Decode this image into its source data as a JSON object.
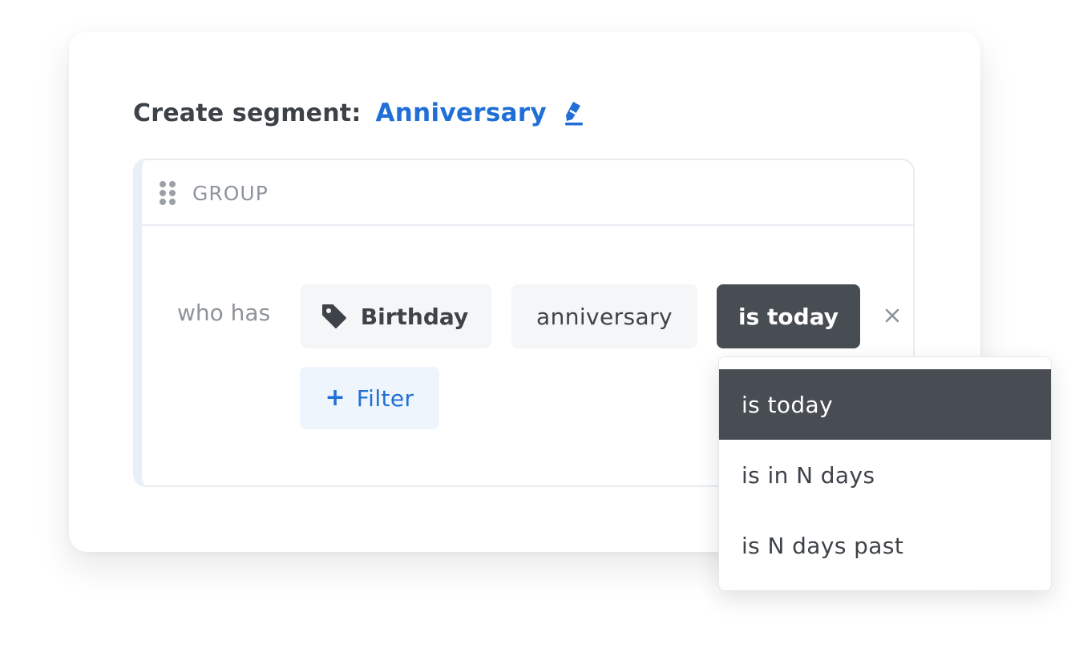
{
  "header": {
    "label": "Create segment:",
    "segment_name": "Anniversary",
    "edit_icon": "pencil-icon"
  },
  "group": {
    "label": "GROUP",
    "drag_icon": "drag-handle-icon"
  },
  "condition": {
    "prefix": "who has",
    "field": {
      "icon": "tag-icon",
      "label": "Birthday"
    },
    "attribute": "anniversary",
    "operator": "is today",
    "remove_icon": "close-icon"
  },
  "add_filter": {
    "icon": "plus-icon",
    "label": "Filter"
  },
  "operator_menu": {
    "selected": "is today",
    "options": [
      "is today",
      "is in N days",
      "is N days past"
    ]
  },
  "colors": {
    "accent": "#1f6fd6",
    "dark_chip": "#484d54",
    "text": "#3e4349",
    "muted": "#8e9399"
  }
}
